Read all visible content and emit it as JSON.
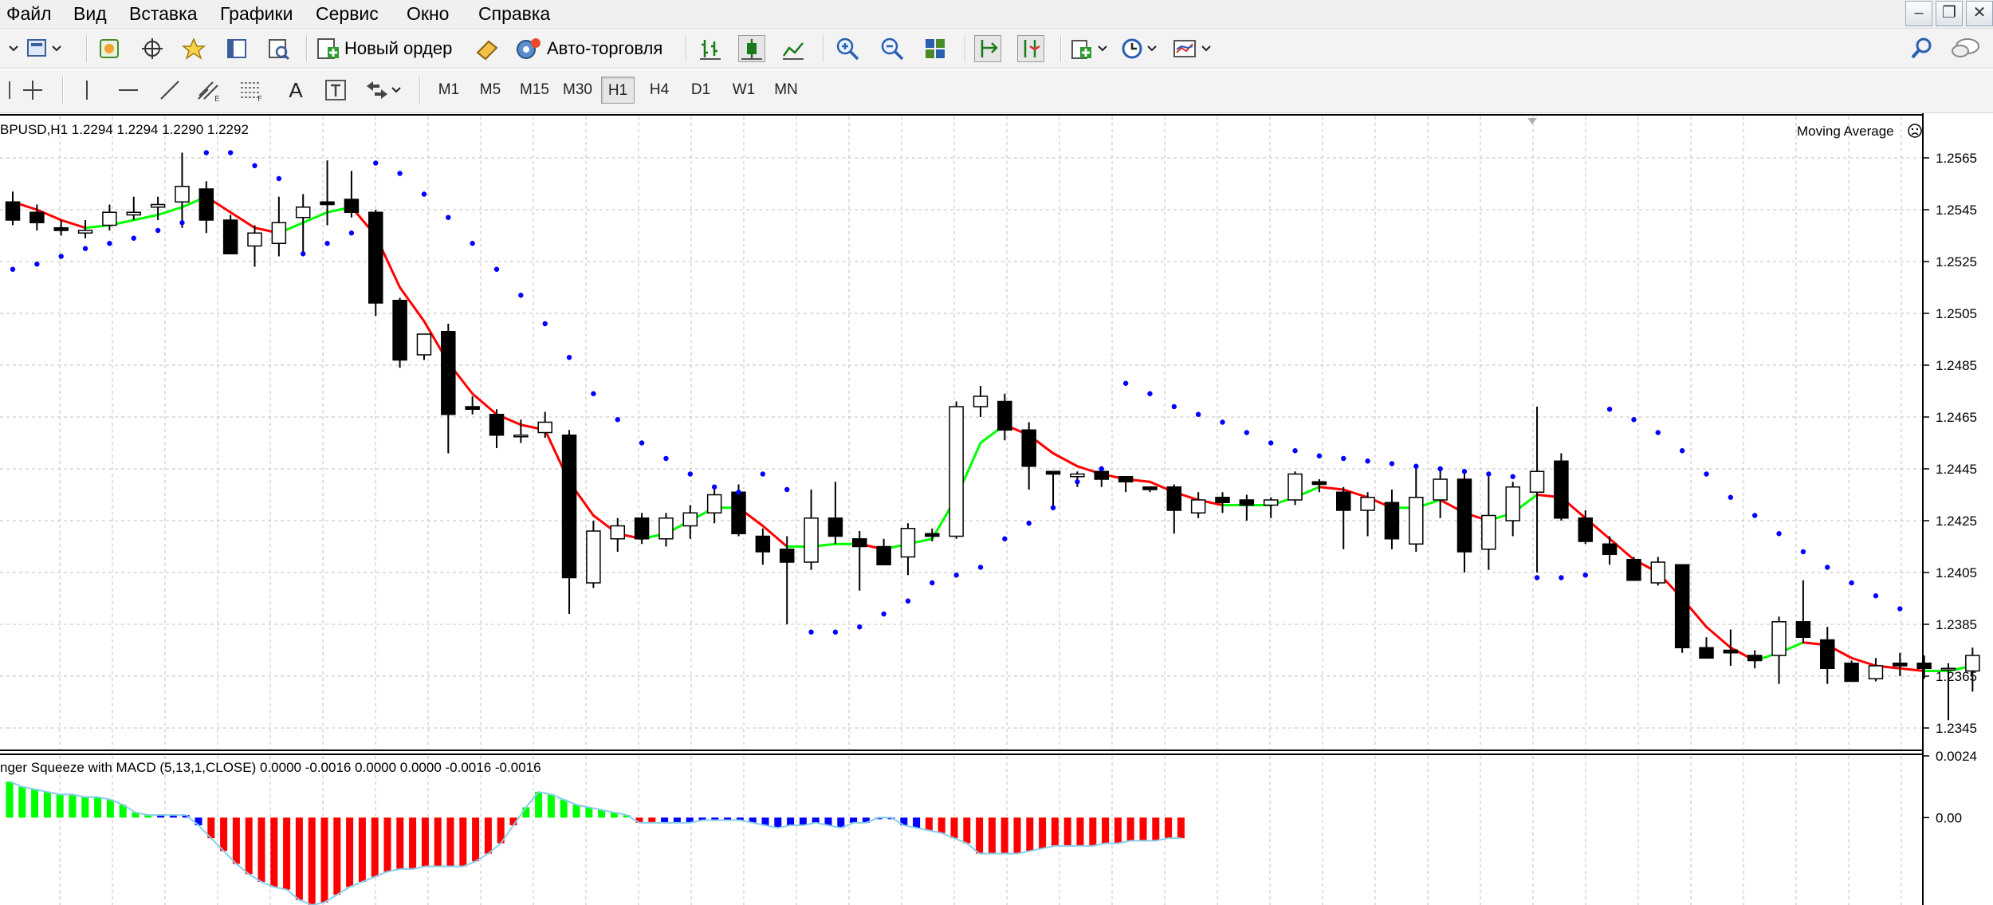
{
  "menu": {
    "items": [
      "Файл",
      "Вид",
      "Вставка",
      "Графики",
      "Сервис",
      "Окно",
      "Справка"
    ]
  },
  "window_controls": {
    "minimize": "‒",
    "restore": "❐",
    "close": "✕"
  },
  "toolbar1": {
    "new_order_label": "Новый ордер",
    "auto_trading_label": "Авто-торговля"
  },
  "toolbar2": {
    "text_tool": "A",
    "timeframes": [
      "M1",
      "M5",
      "M15",
      "M30",
      "H1",
      "H4",
      "D1",
      "W1",
      "MN"
    ],
    "active_timeframe": "H1"
  },
  "chart": {
    "symbol_label": "BPUSD,H1",
    "ohlc_label": "1.2294 1.2294 1.2290 1.2292",
    "indicator_label": "Moving Average",
    "price_ticks": [
      "1.2565",
      "1.2545",
      "1.2525",
      "1.2505",
      "1.2485",
      "1.2465",
      "1.2445",
      "1.2425",
      "1.2405",
      "1.2385",
      "1.2365",
      "1.2345"
    ],
    "colors": {
      "bull": "#ffffff",
      "bear": "#000000",
      "ma_up": "#00ff00",
      "ma_down": "#ff0000",
      "sar": "#0000ff",
      "grid": "#c0c0c0"
    }
  },
  "subwindow": {
    "indicator_label": "nger Squeeze with MACD (5,13,1,CLOSE) 0.0000 -0.0016 0.0000 0.0000 -0.0016 -0.0016",
    "ticks": [
      "0.0024",
      "0.00"
    ],
    "colors": {
      "pos": "#00ff00",
      "neg": "#ff0000",
      "squeeze": "#0000ff",
      "line": "#87ceeb"
    }
  },
  "chart_data": {
    "type": "candlestick",
    "ylim": [
      1.2337,
      1.2581
    ],
    "candles": [
      {
        "o": 1.2548,
        "h": 1.2552,
        "l": 1.2539,
        "c": 1.2541
      },
      {
        "o": 1.2544,
        "h": 1.2547,
        "l": 1.2537,
        "c": 1.254
      },
      {
        "o": 1.2538,
        "h": 1.2541,
        "l": 1.2535,
        "c": 1.2537
      },
      {
        "o": 1.2536,
        "h": 1.2541,
        "l": 1.2534,
        "c": 1.2537
      },
      {
        "o": 1.2539,
        "h": 1.2547,
        "l": 1.2537,
        "c": 1.2544
      },
      {
        "o": 1.2543,
        "h": 1.255,
        "l": 1.2541,
        "c": 1.2544
      },
      {
        "o": 1.2546,
        "h": 1.255,
        "l": 1.2541,
        "c": 1.2547
      },
      {
        "o": 1.2548,
        "h": 1.2567,
        "l": 1.2538,
        "c": 1.2554
      },
      {
        "o": 1.2553,
        "h": 1.2556,
        "l": 1.2536,
        "c": 1.2541
      },
      {
        "o": 1.2541,
        "h": 1.2543,
        "l": 1.2528,
        "c": 1.2528
      },
      {
        "o": 1.2531,
        "h": 1.2539,
        "l": 1.2523,
        "c": 1.2536
      },
      {
        "o": 1.2532,
        "h": 1.255,
        "l": 1.2527,
        "c": 1.254
      },
      {
        "o": 1.2542,
        "h": 1.2551,
        "l": 1.2527,
        "c": 1.2546
      },
      {
        "o": 1.2548,
        "h": 1.2564,
        "l": 1.2539,
        "c": 1.2547
      },
      {
        "o": 1.2549,
        "h": 1.256,
        "l": 1.2542,
        "c": 1.2544
      },
      {
        "o": 1.2544,
        "h": 1.2545,
        "l": 1.2504,
        "c": 1.2509
      },
      {
        "o": 1.251,
        "h": 1.2511,
        "l": 1.2484,
        "c": 1.2487
      },
      {
        "o": 1.2489,
        "h": 1.2497,
        "l": 1.2487,
        "c": 1.2497
      },
      {
        "o": 1.2498,
        "h": 1.2501,
        "l": 1.2451,
        "c": 1.2466
      },
      {
        "o": 1.2469,
        "h": 1.2473,
        "l": 1.2466,
        "c": 1.2468
      },
      {
        "o": 1.2466,
        "h": 1.2468,
        "l": 1.2453,
        "c": 1.2458
      },
      {
        "o": 1.2458,
        "h": 1.2464,
        "l": 1.2455,
        "c": 1.2458
      },
      {
        "o": 1.2459,
        "h": 1.2467,
        "l": 1.2457,
        "c": 1.2463
      },
      {
        "o": 1.2458,
        "h": 1.246,
        "l": 1.2389,
        "c": 1.2403
      },
      {
        "o": 1.2401,
        "h": 1.2425,
        "l": 1.2399,
        "c": 1.2421
      },
      {
        "o": 1.2418,
        "h": 1.2426,
        "l": 1.2413,
        "c": 1.2423
      },
      {
        "o": 1.2426,
        "h": 1.2428,
        "l": 1.2416,
        "c": 1.2418
      },
      {
        "o": 1.2418,
        "h": 1.2428,
        "l": 1.2415,
        "c": 1.2426
      },
      {
        "o": 1.2423,
        "h": 1.2431,
        "l": 1.2418,
        "c": 1.2428
      },
      {
        "o": 1.2428,
        "h": 1.2437,
        "l": 1.2424,
        "c": 1.2435
      },
      {
        "o": 1.2436,
        "h": 1.2439,
        "l": 1.2419,
        "c": 1.242
      },
      {
        "o": 1.2419,
        "h": 1.2422,
        "l": 1.2408,
        "c": 1.2413
      },
      {
        "o": 1.2414,
        "h": 1.2419,
        "l": 1.2385,
        "c": 1.2409
      },
      {
        "o": 1.2409,
        "h": 1.2437,
        "l": 1.2406,
        "c": 1.2426
      },
      {
        "o": 1.2426,
        "h": 1.244,
        "l": 1.2416,
        "c": 1.2419
      },
      {
        "o": 1.2418,
        "h": 1.2421,
        "l": 1.2398,
        "c": 1.2415
      },
      {
        "o": 1.2415,
        "h": 1.2418,
        "l": 1.2408,
        "c": 1.2408
      },
      {
        "o": 1.2411,
        "h": 1.2424,
        "l": 1.2404,
        "c": 1.2422
      },
      {
        "o": 1.242,
        "h": 1.2422,
        "l": 1.2417,
        "c": 1.2419
      },
      {
        "o": 1.2419,
        "h": 1.2471,
        "l": 1.2418,
        "c": 1.2469
      },
      {
        "o": 1.2469,
        "h": 1.2477,
        "l": 1.2465,
        "c": 1.2473
      },
      {
        "o": 1.2471,
        "h": 1.2474,
        "l": 1.2456,
        "c": 1.246
      },
      {
        "o": 1.246,
        "h": 1.2463,
        "l": 1.2437,
        "c": 1.2446
      },
      {
        "o": 1.2444,
        "h": 1.2444,
        "l": 1.2429,
        "c": 1.2443
      },
      {
        "o": 1.2442,
        "h": 1.2444,
        "l": 1.2438,
        "c": 1.2443
      },
      {
        "o": 1.2444,
        "h": 1.2446,
        "l": 1.2438,
        "c": 1.2441
      },
      {
        "o": 1.2442,
        "h": 1.2442,
        "l": 1.2436,
        "c": 1.244
      },
      {
        "o": 1.2438,
        "h": 1.2438,
        "l": 1.2436,
        "c": 1.2437
      },
      {
        "o": 1.2438,
        "h": 1.2439,
        "l": 1.242,
        "c": 1.2429
      },
      {
        "o": 1.2428,
        "h": 1.2436,
        "l": 1.2426,
        "c": 1.2433
      },
      {
        "o": 1.2434,
        "h": 1.2436,
        "l": 1.2428,
        "c": 1.2432
      },
      {
        "o": 1.2433,
        "h": 1.2435,
        "l": 1.2425,
        "c": 1.2431
      },
      {
        "o": 1.2431,
        "h": 1.2434,
        "l": 1.2426,
        "c": 1.2433
      },
      {
        "o": 1.2433,
        "h": 1.2444,
        "l": 1.2431,
        "c": 1.2443
      },
      {
        "o": 1.244,
        "h": 1.2441,
        "l": 1.2436,
        "c": 1.2439
      },
      {
        "o": 1.2436,
        "h": 1.2438,
        "l": 1.2414,
        "c": 1.2429
      },
      {
        "o": 1.2429,
        "h": 1.2436,
        "l": 1.2419,
        "c": 1.2434
      },
      {
        "o": 1.2432,
        "h": 1.2437,
        "l": 1.2414,
        "c": 1.2418
      },
      {
        "o": 1.2416,
        "h": 1.2446,
        "l": 1.2413,
        "c": 1.2434
      },
      {
        "o": 1.2433,
        "h": 1.2446,
        "l": 1.2426,
        "c": 1.2441
      },
      {
        "o": 1.2441,
        "h": 1.2445,
        "l": 1.2405,
        "c": 1.2413
      },
      {
        "o": 1.2414,
        "h": 1.2442,
        "l": 1.2406,
        "c": 1.2427
      },
      {
        "o": 1.2425,
        "h": 1.244,
        "l": 1.2419,
        "c": 1.2438
      },
      {
        "o": 1.2436,
        "h": 1.2469,
        "l": 1.2405,
        "c": 1.2444
      },
      {
        "o": 1.2448,
        "h": 1.2451,
        "l": 1.2425,
        "c": 1.2426
      },
      {
        "o": 1.2426,
        "h": 1.2429,
        "l": 1.2416,
        "c": 1.2417
      },
      {
        "o": 1.2416,
        "h": 1.2419,
        "l": 1.2408,
        "c": 1.2412
      },
      {
        "o": 1.241,
        "h": 1.2411,
        "l": 1.2402,
        "c": 1.2402
      },
      {
        "o": 1.2401,
        "h": 1.2411,
        "l": 1.24,
        "c": 1.2409
      },
      {
        "o": 1.2408,
        "h": 1.2408,
        "l": 1.2374,
        "c": 1.2376
      },
      {
        "o": 1.2376,
        "h": 1.238,
        "l": 1.2372,
        "c": 1.2372
      },
      {
        "o": 1.2375,
        "h": 1.2383,
        "l": 1.2369,
        "c": 1.2374
      },
      {
        "o": 1.2373,
        "h": 1.2375,
        "l": 1.2368,
        "c": 1.2371
      },
      {
        "o": 1.2373,
        "h": 1.2388,
        "l": 1.2362,
        "c": 1.2386
      },
      {
        "o": 1.2386,
        "h": 1.2402,
        "l": 1.2378,
        "c": 1.238
      },
      {
        "o": 1.2379,
        "h": 1.2384,
        "l": 1.2362,
        "c": 1.2368
      },
      {
        "o": 1.237,
        "h": 1.2371,
        "l": 1.2363,
        "c": 1.2363
      },
      {
        "o": 1.2364,
        "h": 1.2372,
        "l": 1.2363,
        "c": 1.2369
      },
      {
        "o": 1.237,
        "h": 1.2374,
        "l": 1.2365,
        "c": 1.2369
      },
      {
        "o": 1.237,
        "h": 1.2373,
        "l": 1.2364,
        "c": 1.2368
      },
      {
        "o": 1.2368,
        "h": 1.237,
        "l": 1.2348,
        "c": 1.2368
      },
      {
        "o": 1.2367,
        "h": 1.2376,
        "l": 1.2359,
        "c": 1.2373
      }
    ],
    "ma": [
      1.2548,
      1.2545,
      1.2541,
      1.2538,
      1.2539,
      1.2541,
      1.2543,
      1.2546,
      1.255,
      1.2544,
      1.2538,
      1.2536,
      1.254,
      1.2544,
      1.2546,
      1.2535,
      1.2515,
      1.2502,
      1.2486,
      1.2474,
      1.2466,
      1.2462,
      1.246,
      1.244,
      1.2427,
      1.242,
      1.2418,
      1.242,
      1.2425,
      1.243,
      1.243,
      1.2423,
      1.2415,
      1.2415,
      1.2416,
      1.2416,
      1.2414,
      1.2416,
      1.2418,
      1.2434,
      1.2455,
      1.2462,
      1.2458,
      1.2451,
      1.2446,
      1.2443,
      1.2441,
      1.244,
      1.2436,
      1.2433,
      1.2431,
      1.2431,
      1.2431,
      1.2434,
      1.2438,
      1.2437,
      1.2434,
      1.243,
      1.243,
      1.2433,
      1.2428,
      1.2425,
      1.2428,
      1.2435,
      1.2434,
      1.2426,
      1.2418,
      1.241,
      1.2405,
      1.2395,
      1.2384,
      1.2376,
      1.2371,
      1.2374,
      1.2378,
      1.2377,
      1.2372,
      1.2369,
      1.2368,
      1.2367,
      1.2367,
      1.2369
    ],
    "sar": [
      1.2522,
      1.2524,
      1.2527,
      1.253,
      1.2532,
      1.2534,
      1.2537,
      1.254,
      1.2567,
      1.2567,
      1.2562,
      1.2557,
      1.2528,
      1.2532,
      1.2536,
      1.2563,
      1.2559,
      1.2551,
      1.2542,
      1.2532,
      1.2522,
      1.2512,
      1.2501,
      1.2488,
      1.2474,
      1.2464,
      1.2455,
      1.2449,
      1.2443,
      1.2438,
      1.2436,
      1.2443,
      1.2437,
      1.2382,
      1.2382,
      1.2384,
      1.2389,
      1.2394,
      1.2401,
      1.2404,
      1.2407,
      1.2418,
      1.2424,
      1.243,
      1.244,
      1.2445,
      1.2478,
      1.2474,
      1.2469,
      1.2466,
      1.2463,
      1.2459,
      1.2455,
      1.2452,
      1.245,
      1.2449,
      1.2448,
      1.2447,
      1.2446,
      1.2445,
      1.2444,
      1.2443,
      1.2442,
      1.2403,
      1.2403,
      1.2404,
      1.2468,
      1.2464,
      1.2459,
      1.2452,
      1.2443,
      1.2434,
      1.2427,
      1.242,
      1.2413,
      1.2407,
      1.2401,
      1.2396,
      1.2391
    ],
    "sub_ylim": [
      -0.0034,
      0.0024
    ],
    "macd": [
      0.0014,
      0.0012,
      0.0011,
      0.001,
      0.0009,
      0.0009,
      0.0008,
      0.0008,
      0.0007,
      0.0005,
      0.0002,
      0.0001,
      0.0001,
      0.0001,
      0.0001,
      -0.0003,
      -0.0008,
      -0.0013,
      -0.0018,
      -0.0022,
      -0.0025,
      -0.0027,
      -0.0028,
      -0.0032,
      -0.0034,
      -0.0033,
      -0.003,
      -0.0027,
      -0.0025,
      -0.0023,
      -0.0021,
      -0.002,
      -0.002,
      -0.0019,
      -0.0019,
      -0.0019,
      -0.0019,
      -0.0017,
      -0.0014,
      -0.001,
      -0.0003,
      0.0004,
      0.001,
      0.0009,
      0.0007,
      0.0005,
      0.0004,
      0.0003,
      0.0002,
      0.0001,
      -0.0002,
      -0.0002,
      -0.0002,
      -0.0002,
      -0.0002,
      -0.0001,
      -0.0001,
      -0.0001,
      -0.0001,
      -0.0002,
      -0.0003,
      -0.0004,
      -0.0003,
      -0.0003,
      -0.0002,
      -0.0003,
      -0.0004,
      -0.0002,
      -0.0002,
      0.0,
      0.0,
      -0.0003,
      -0.0004,
      -0.0005,
      -0.0006,
      -0.0008,
      -0.001,
      -0.0014,
      -0.0014,
      -0.0014,
      -0.0014,
      -0.0013,
      -0.0012,
      -0.0011,
      -0.0011,
      -0.0011,
      -0.0011,
      -0.001,
      -0.001,
      -0.0009,
      -0.0009,
      -0.0009,
      -0.0008,
      -0.0008
    ],
    "squeeze_bars": [
      12,
      13,
      14,
      15,
      52,
      53,
      54,
      55,
      56,
      57,
      58,
      59,
      60,
      61,
      62,
      63,
      64,
      65,
      66,
      67,
      68,
      69,
      70,
      71,
      72,
      73,
      74,
      75,
      76,
      77,
      78,
      79,
      80,
      81,
      82,
      83
    ]
  }
}
